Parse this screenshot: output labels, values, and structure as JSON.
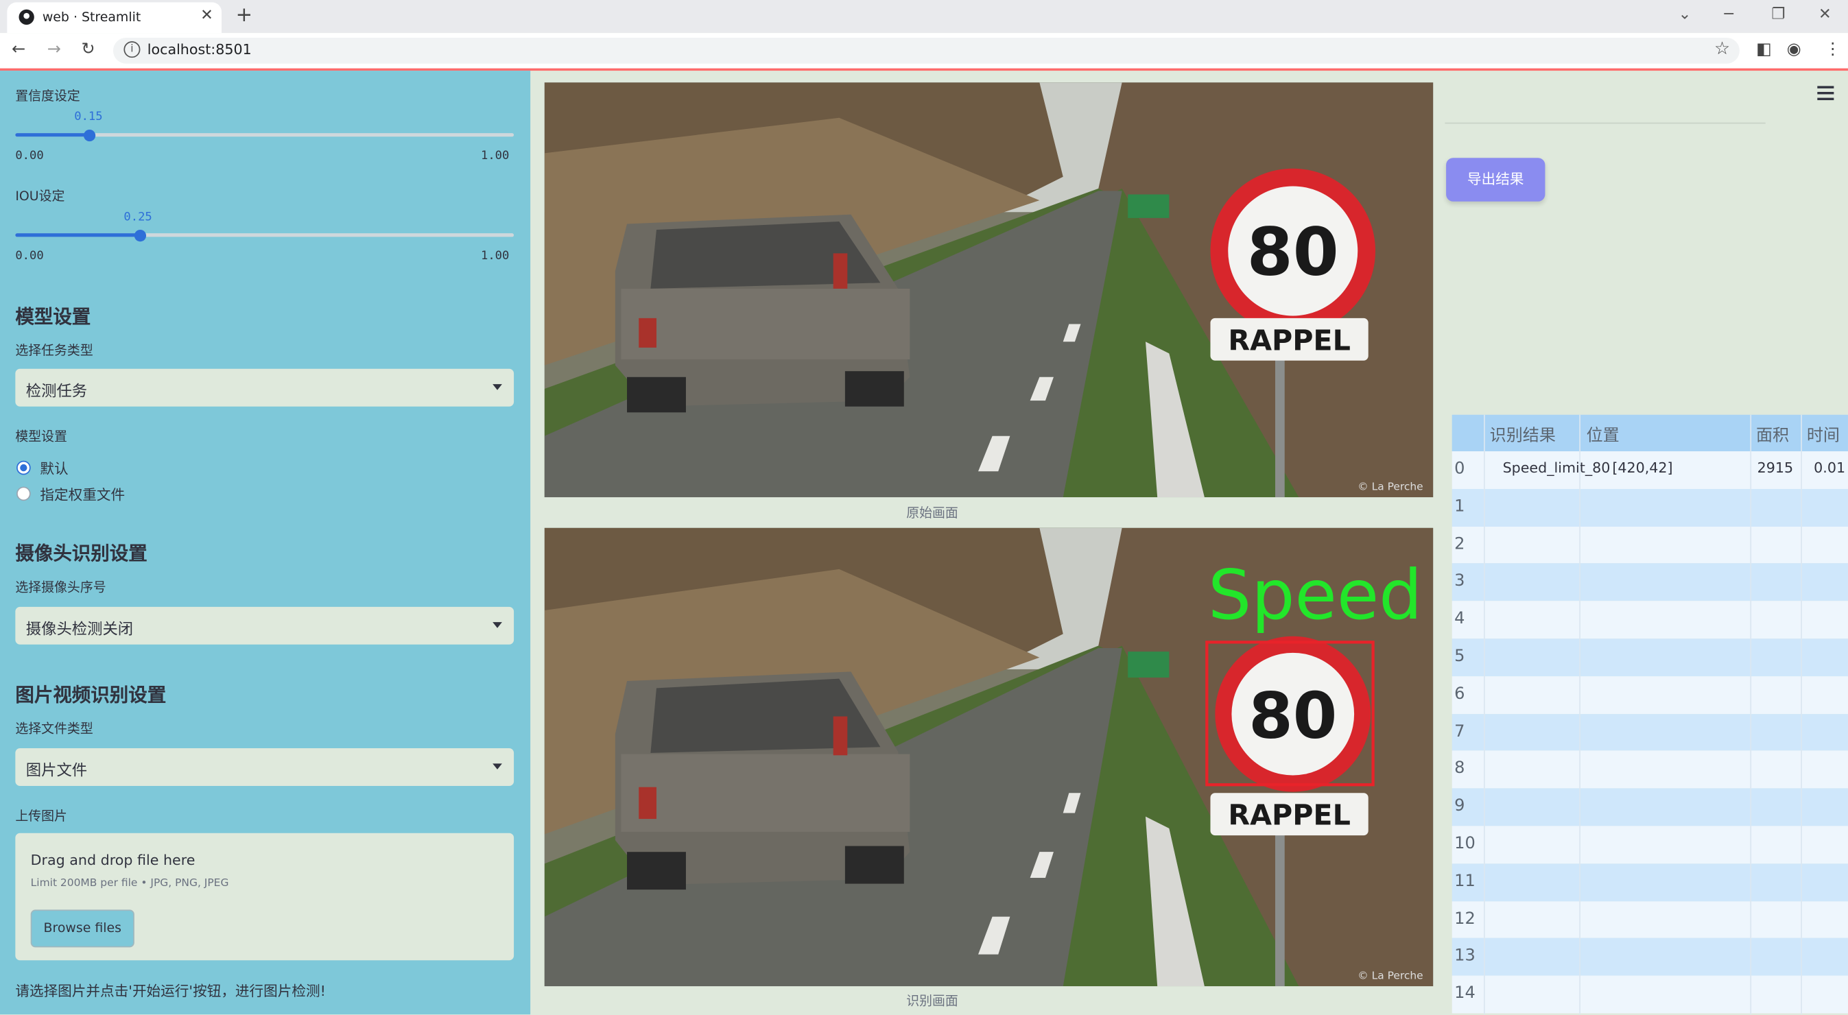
{
  "browser": {
    "tab_title": "web · Streamlit",
    "url": "localhost:8501"
  },
  "sidebar": {
    "confidence": {
      "label": "置信度设定",
      "value": "0.15",
      "min": "0.00",
      "max": "1.00",
      "fraction": 0.15
    },
    "iou": {
      "label": "IOU设定",
      "value": "0.25",
      "min": "0.00",
      "max": "1.00",
      "fraction": 0.25
    },
    "model_section": {
      "title": "模型设置",
      "task_label": "选择任务类型",
      "task_value": "检测任务",
      "model_label": "模型设置",
      "options": [
        "默认",
        "指定权重文件"
      ],
      "selected": 0
    },
    "camera_section": {
      "title": "摄像头识别设置",
      "camera_label": "选择摄像头序号",
      "camera_value": "摄像头检测关闭"
    },
    "media_section": {
      "title": "图片视频识别设置",
      "file_type_label": "选择文件类型",
      "file_type_value": "图片文件",
      "upload_label": "上传图片",
      "drag_text": "Drag and drop file here",
      "limit_text": "Limit 200MB per file • JPG, PNG, JPEG",
      "browse_label": "Browse files"
    },
    "hint": "请选择图片并点击'开始运行'按钮，进行图片检测!"
  },
  "main": {
    "original_caption": "原始画面",
    "detected_caption": "识别画面",
    "sign_number": "80",
    "sign_text": "RAPPEL",
    "watermark": "© La Perche",
    "overlay_label": "Speed",
    "export_label": "导出结果"
  },
  "results_table": {
    "columns": [
      "识别结果",
      "位置",
      "面积",
      "时间"
    ],
    "index": [
      "0",
      "1",
      "2",
      "3",
      "4",
      "5",
      "6",
      "7",
      "8",
      "9",
      "10",
      "11",
      "12",
      "13",
      "14"
    ],
    "rows": [
      {
        "label": "Speed_limit_80",
        "position": "[420,42]",
        "area": "2915",
        "time": "0.01"
      }
    ]
  },
  "colors": {
    "sidebar": "#7ec8d9",
    "accent": "#2e6fd8",
    "export_button": "#8a8cf0",
    "detection_box": "#e8232a",
    "detection_text": "#22e62a"
  }
}
